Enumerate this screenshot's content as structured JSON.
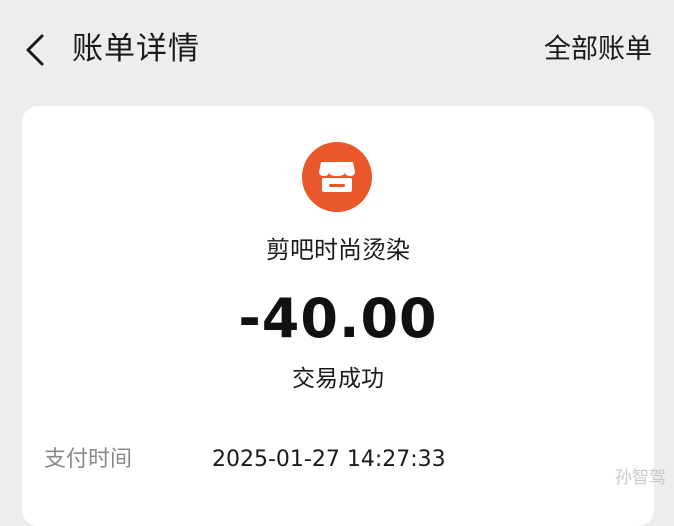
{
  "header": {
    "title": "账单详情",
    "all_bills_label": "全部账单"
  },
  "transaction": {
    "merchant_name": "剪吧时尚烫染",
    "amount": "-40.00",
    "status": "交易成功",
    "merchant_icon": "storefront-icon",
    "accent_color": "#e9572a"
  },
  "details": [
    {
      "label": "支付时间",
      "value": "2025-01-27 14:27:33"
    }
  ],
  "watermark": "孙智驾"
}
